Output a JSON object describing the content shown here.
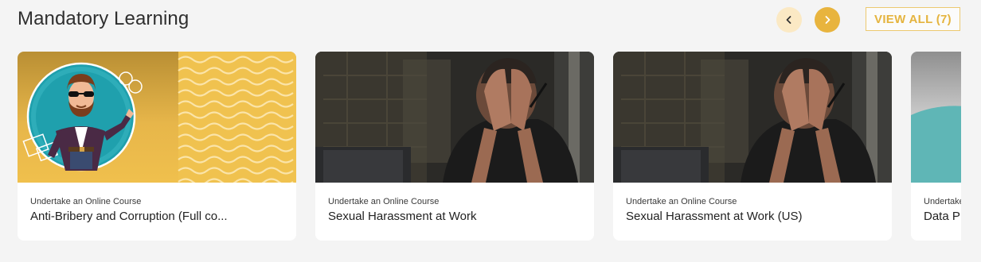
{
  "section": {
    "title": "Mandatory Learning",
    "view_all_label": "VIEW ALL (7)"
  },
  "navigation": {
    "prev_icon": "chevron-left-icon",
    "next_icon": "chevron-right-icon"
  },
  "colors": {
    "accent": "#e8b43e",
    "accent_light": "#fbe9c4",
    "background": "#f4f4f4"
  },
  "cards": [
    {
      "type": "Undertake an Online Course",
      "name": "Anti-Bribery and Corruption (Full co...",
      "image": "cartoon-man-illustration"
    },
    {
      "type": "Undertake an Online Course",
      "name": "Sexual Harassment at Work",
      "image": "distressed-person-photo"
    },
    {
      "type": "Undertake an Online Course",
      "name": "Sexual Harassment at Work (US)",
      "image": "distressed-person-photo"
    },
    {
      "type": "Undertake",
      "name": "Data P",
      "image": "abstract-teal-photo"
    }
  ]
}
